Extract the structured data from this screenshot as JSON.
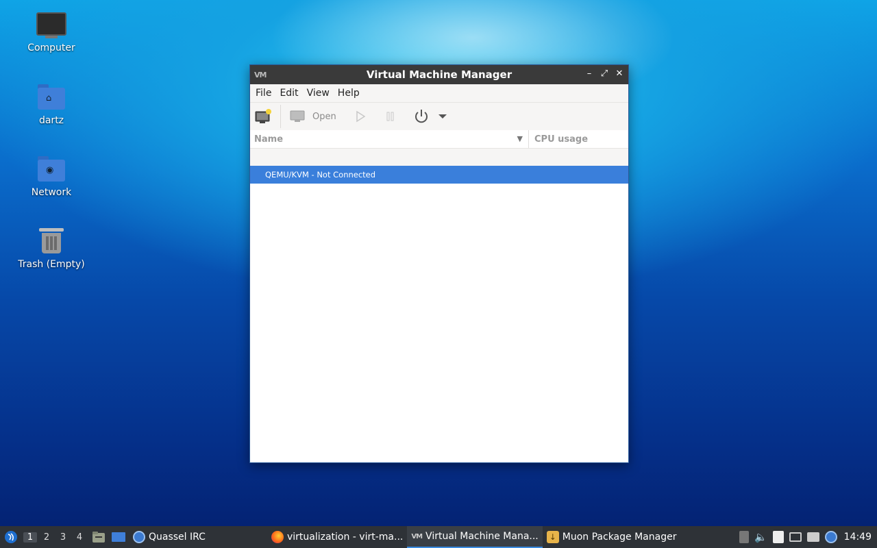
{
  "desktop": {
    "icons": [
      {
        "label": "Computer"
      },
      {
        "label": "dartz"
      },
      {
        "label": "Network"
      },
      {
        "label": "Trash (Empty)"
      }
    ]
  },
  "window": {
    "title": "Virtual Machine Manager",
    "menus": [
      "File",
      "Edit",
      "View",
      "Help"
    ],
    "toolbar": {
      "open_label": "Open"
    },
    "table": {
      "columns": [
        "Name",
        "CPU usage"
      ],
      "rows": [
        {
          "name": "QEMU/KVM - Not Connected",
          "selected": true
        }
      ]
    }
  },
  "taskbar": {
    "workspaces": [
      "1",
      "2",
      "3",
      "4"
    ],
    "tasks": [
      {
        "label": "Quassel IRC",
        "icon": "quassel-icon"
      },
      {
        "label": "virtualization - virt-ma...",
        "icon": "firefox-icon"
      },
      {
        "label": "Virtual Machine Mana...",
        "icon": "virt-manager-icon"
      },
      {
        "label": "Muon Package Manager",
        "icon": "muon-icon"
      }
    ],
    "clock": "14:49"
  },
  "colors": {
    "selection": "#3a7fdb",
    "titlebar": "#3a3a3a",
    "taskbar": "#2e3237"
  }
}
